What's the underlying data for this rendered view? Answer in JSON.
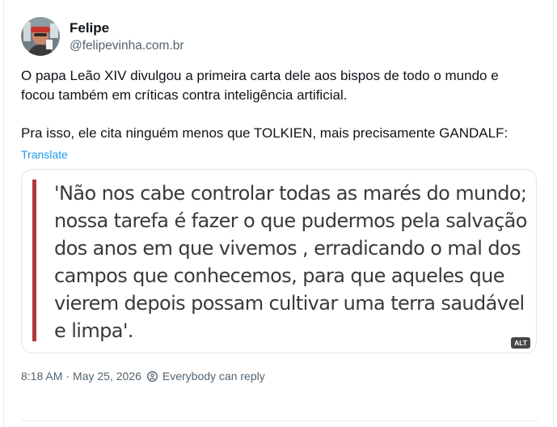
{
  "author": {
    "display_name": "Felipe",
    "handle": "@felipevinha.com.br",
    "avatar_icon": "avatar-photo"
  },
  "post": {
    "paragraphs": [
      "O papa Leão XIV divulgou a primeira carta dele aos bispos de todo o mundo e focou também em críticas contra inteligência artificial.",
      "Pra isso, ele cita ninguém menos que TOLKIEN, mais precisamente GANDALF:"
    ],
    "translate_label": "Translate",
    "image": {
      "quote_text": "'Não nos cabe controlar todas as marés do mundo; nossa tarefa é fazer o que pudermos pela salvação dos anos em que vivemos , erradicando o mal dos campos que conhecemos, para que aqueles que vierem depois possam cultivar uma terra saudável e limpa'.",
      "alt_badge": "ALT",
      "accent_color": "#b3393b"
    },
    "time": "8:18 AM",
    "separator": "·",
    "date": "May 25, 2026",
    "reply_setting": "Everybody can reply"
  },
  "colors": {
    "link": "#1d9bf0",
    "secondary_text": "#536471"
  }
}
